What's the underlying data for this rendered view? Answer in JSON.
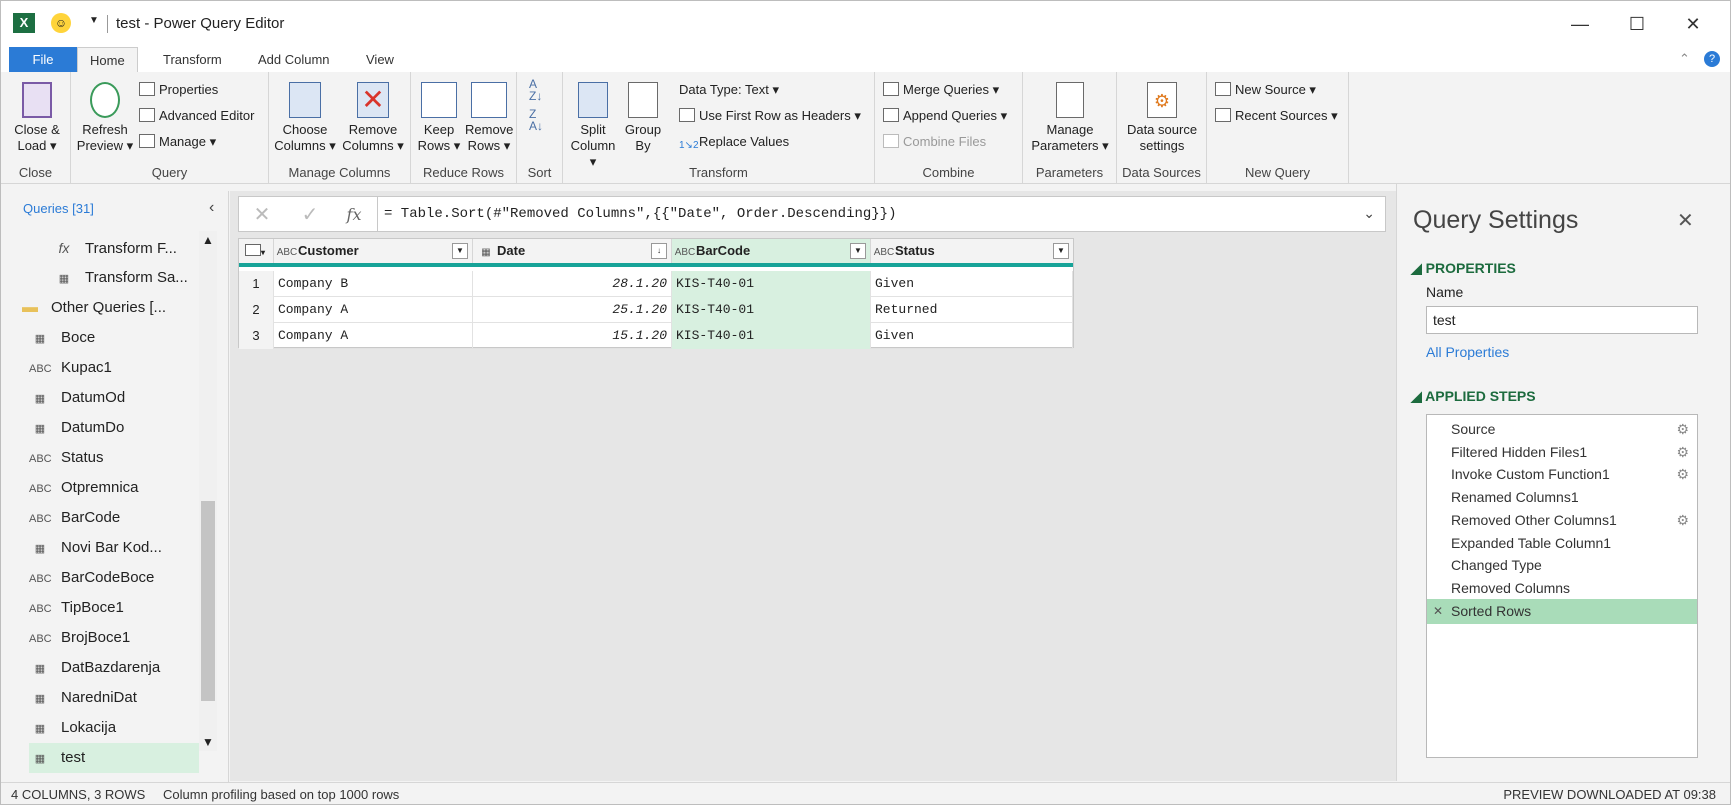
{
  "window": {
    "title": "test - Power Query Editor"
  },
  "titlebar_controls": {
    "minimize": "—",
    "maximize": "☐",
    "close": "✕"
  },
  "tabs": [
    "File",
    "Home",
    "Transform",
    "Add Column",
    "View"
  ],
  "ribbon": {
    "close": {
      "button": "Close & Load",
      "group": "Close"
    },
    "query": {
      "refresh": "Refresh Preview",
      "properties": "Properties",
      "advanced": "Advanced Editor",
      "manage": "Manage",
      "group": "Query"
    },
    "manage_columns": {
      "choose": "Choose Columns",
      "remove": "Remove Columns",
      "group": "Manage Columns"
    },
    "reduce_rows": {
      "keep": "Keep Rows",
      "remove": "Remove Rows",
      "group": "Reduce Rows"
    },
    "sort": {
      "group": "Sort"
    },
    "transform": {
      "split": "Split Column",
      "group_by": "Group By",
      "data_type": "Data Type: Text",
      "first_row": "Use First Row as Headers",
      "replace": "Replace Values",
      "group": "Transform"
    },
    "combine": {
      "merge": "Merge Queries",
      "append": "Append Queries",
      "combine_files": "Combine Files",
      "group": "Combine"
    },
    "parameters": {
      "manage": "Manage Parameters",
      "group": "Parameters"
    },
    "data_sources": {
      "settings": "Data source settings",
      "group": "Data Sources"
    },
    "new_query": {
      "new_source": "New Source",
      "recent": "Recent Sources",
      "group": "New Query"
    }
  },
  "queries": {
    "header": "Queries [31]",
    "items": [
      {
        "label": "Transform F...",
        "type": "fx"
      },
      {
        "label": "Transform Sa...",
        "type": "table"
      },
      {
        "label": "Other Queries [...",
        "type": "folder"
      },
      {
        "label": "Boce",
        "type": "table"
      },
      {
        "label": "Kupac1",
        "type": "ABC"
      },
      {
        "label": "DatumOd",
        "type": "date"
      },
      {
        "label": "DatumDo",
        "type": "date"
      },
      {
        "label": "Status",
        "type": "ABC"
      },
      {
        "label": "Otpremnica",
        "type": "ABC"
      },
      {
        "label": "BarCode",
        "type": "ABC"
      },
      {
        "label": "Novi Bar Kod...",
        "type": "table"
      },
      {
        "label": "BarCodeBoce",
        "type": "ABC"
      },
      {
        "label": "TipBoce1",
        "type": "ABC"
      },
      {
        "label": "BrojBoce1",
        "type": "ABC"
      },
      {
        "label": "DatBazdarenja",
        "type": "date"
      },
      {
        "label": "NaredniDat",
        "type": "date"
      },
      {
        "label": "Lokacija",
        "type": "table"
      },
      {
        "label": "test",
        "type": "table",
        "selected": true
      }
    ]
  },
  "formula": {
    "fx": "fx",
    "text": "= Table.Sort(#\"Removed Columns\",{{\"Date\", Order.Descending}})"
  },
  "grid": {
    "columns": [
      "Customer",
      "Date",
      "BarCode",
      "Status"
    ],
    "rows": [
      {
        "n": "1",
        "c": "Company B",
        "d": "28.1.20",
        "b": "KIS-T40-01",
        "s": "Given"
      },
      {
        "n": "2",
        "c": "Company A",
        "d": "25.1.20",
        "b": "KIS-T40-01",
        "s": "Returned"
      },
      {
        "n": "3",
        "c": "Company A",
        "d": "15.1.20",
        "b": "KIS-T40-01",
        "s": "Given"
      }
    ]
  },
  "settings": {
    "title": "Query Settings",
    "properties": "PROPERTIES",
    "name_label": "Name",
    "name_value": "test",
    "all_properties": "All Properties",
    "applied_steps": "APPLIED STEPS",
    "steps": [
      {
        "label": "Source",
        "gear": true
      },
      {
        "label": "Filtered Hidden Files1",
        "gear": true
      },
      {
        "label": "Invoke Custom Function1",
        "gear": true
      },
      {
        "label": "Renamed Columns1",
        "gear": false
      },
      {
        "label": "Removed Other Columns1",
        "gear": true
      },
      {
        "label": "Expanded Table Column1",
        "gear": false
      },
      {
        "label": "Changed Type",
        "gear": false
      },
      {
        "label": "Removed Columns",
        "gear": false
      },
      {
        "label": "Sorted Rows",
        "gear": false,
        "selected": true
      }
    ]
  },
  "status": {
    "left": "4 COLUMNS, 3 ROWS",
    "profiling": "Column profiling based on top 1000 rows",
    "right": "PREVIEW DOWNLOADED AT 09:38"
  }
}
